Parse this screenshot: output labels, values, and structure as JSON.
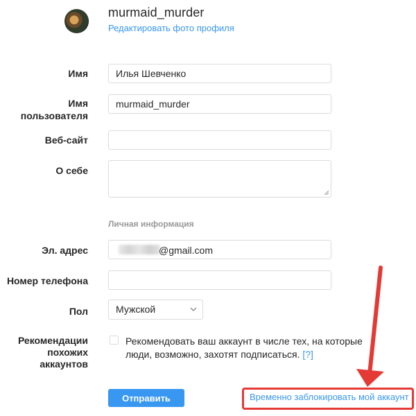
{
  "profile": {
    "username": "murmaid_murder",
    "edit_photo_link": "Редактировать фото профиля"
  },
  "form": {
    "name_label": "Имя",
    "name_value": "Илья Шевченко",
    "username_label_line1": "Имя",
    "username_label_line2": "пользователя",
    "username_value": "murmaid_murder",
    "website_label": "Веб-сайт",
    "website_value": "",
    "bio_label": "О себе",
    "bio_value": "",
    "personal_info_title": "Личная информация",
    "email_label": "Эл. адрес",
    "email_visible_suffix": "@gmail.com",
    "phone_label": "Номер телефона",
    "phone_value": "",
    "gender_label": "Пол",
    "gender_value": "Мужской",
    "recommend_label_line1": "Рекомендации",
    "recommend_label_line2": "похожих",
    "recommend_label_line3": "аккаунтов",
    "recommend_text_line1": "Рекомендовать ваш аккаунт в числе тех, на которые",
    "recommend_text_line2": "люди, возможно, захотят подписаться.",
    "recommend_help": "[?]",
    "recommend_checked": false,
    "submit_label": "Отправить",
    "disable_account_link": "Временно заблокировать мой аккаунт"
  },
  "colors": {
    "accent": "#3897f0",
    "annotation": "#e53935",
    "border": "#dbdbdb"
  }
}
